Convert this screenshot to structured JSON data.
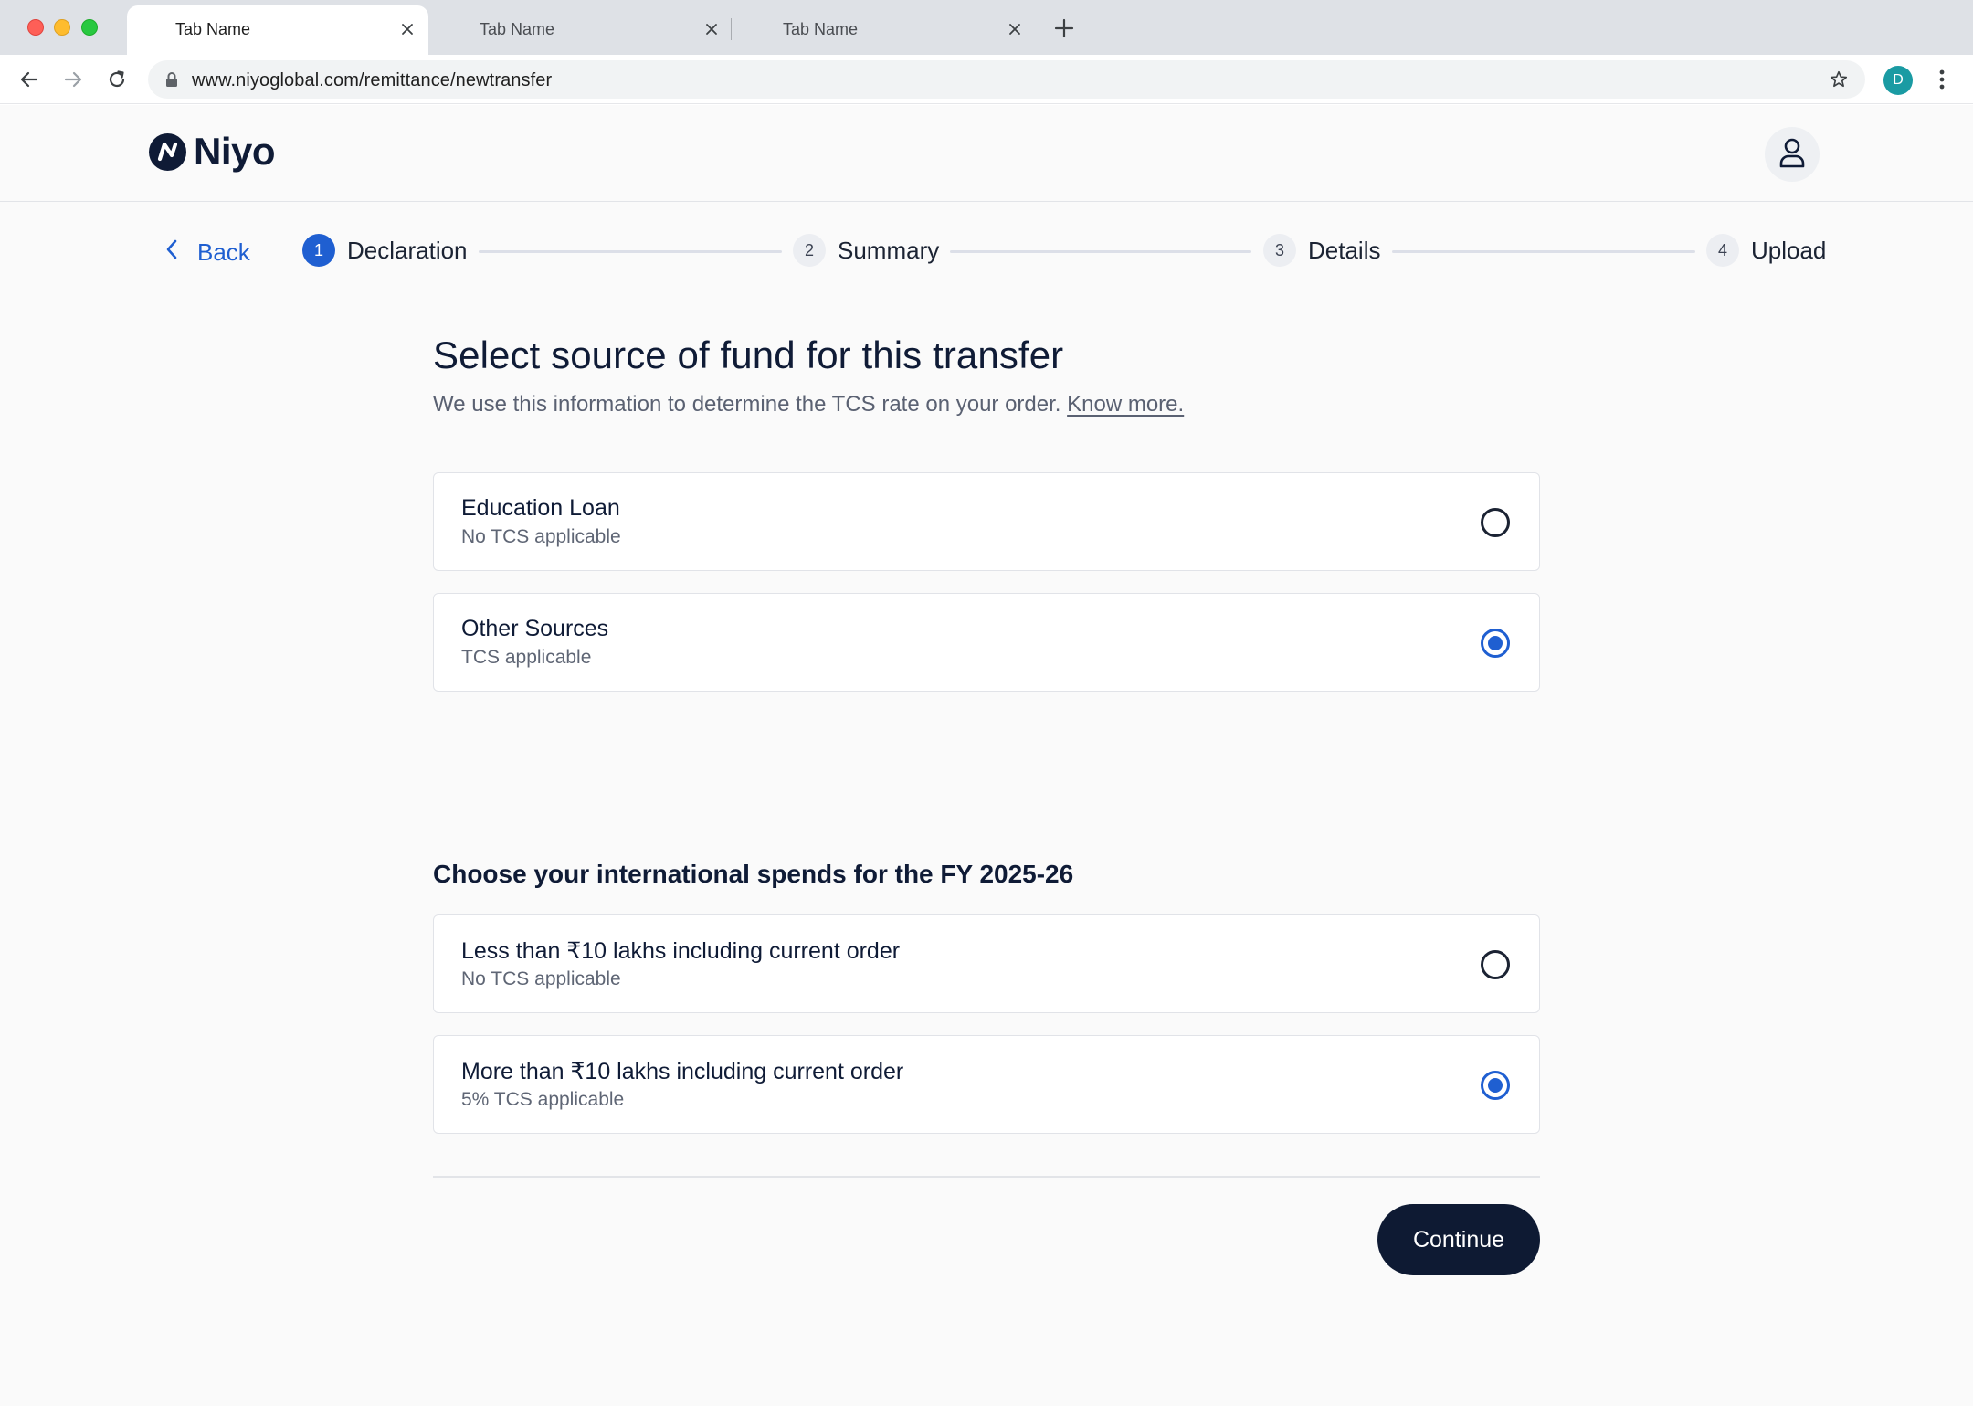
{
  "browser": {
    "tabs": [
      {
        "label": "Tab Name",
        "active": true
      },
      {
        "label": "Tab Name",
        "active": false
      },
      {
        "label": "Tab Name",
        "active": false
      }
    ],
    "url": "www.niyoglobal.com/remittance/newtransfer",
    "profile_initial": "D"
  },
  "header": {
    "brand": "Niyo",
    "logo_mark": "N"
  },
  "stepper": {
    "back_label": "Back",
    "steps": [
      {
        "number": "1",
        "label": "Declaration",
        "current": true
      },
      {
        "number": "2",
        "label": "Summary",
        "current": false
      },
      {
        "number": "3",
        "label": "Details",
        "current": false
      },
      {
        "number": "4",
        "label": "Upload",
        "current": false
      }
    ]
  },
  "main": {
    "title": "Select source of fund for this transfer",
    "subtitle": "We use this information to determine the TCS rate on your order.",
    "know_more": "Know more.",
    "fund_sources": [
      {
        "title": "Education Loan",
        "desc": "No TCS applicable",
        "selected": false
      },
      {
        "title": "Other Sources",
        "desc": "TCS applicable",
        "selected": true
      }
    ],
    "spends_heading": "Choose your international spends for the FY 2025-26",
    "spends": [
      {
        "title": "Less than ₹10 lakhs including current order",
        "desc": "No TCS applicable",
        "selected": false
      },
      {
        "title": "More than ₹10 lakhs including current order",
        "desc": "5% TCS applicable",
        "selected": true
      }
    ],
    "continue_label": "Continue"
  },
  "colors": {
    "accent": "#1f5fd1",
    "primary_dark": "#0e1a33",
    "text_muted": "#5a6172"
  },
  "icons": [
    "back-arrow-icon",
    "forward-arrow-icon",
    "reload-icon",
    "lock-icon",
    "star-icon",
    "kebab-menu-icon",
    "close-icon",
    "plus-icon",
    "user-icon",
    "chevron-left-icon"
  ]
}
